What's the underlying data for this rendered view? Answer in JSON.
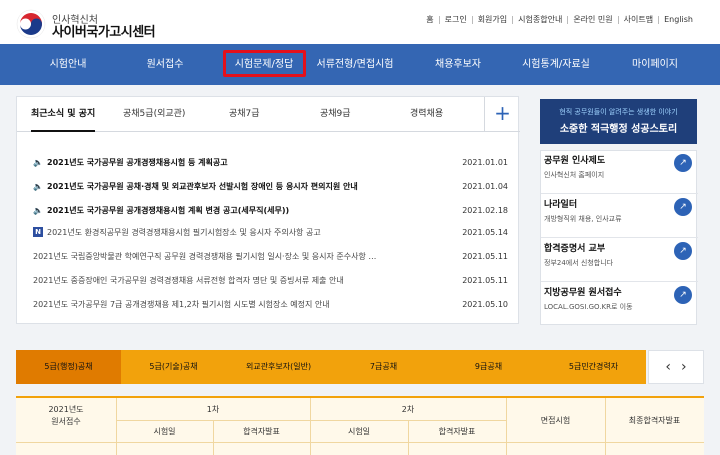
{
  "header": {
    "org_small": "인사혁신처",
    "org_title": "사이버국가고시센터",
    "util_links": [
      "홈",
      "로그인",
      "회원가입",
      "시험종합안내",
      "온라인 민원",
      "사이트맵",
      "English"
    ]
  },
  "nav": {
    "items": [
      "시험안내",
      "원서접수",
      "시험문제/정답",
      "서류전형/면접시험",
      "채용후보자",
      "시험통계/자료실",
      "마이페이지"
    ]
  },
  "news": {
    "tabs": [
      "최근소식 및 공지",
      "공채5급(외교관)",
      "공채7급",
      "공채9급",
      "경력채용"
    ],
    "plus": "+",
    "rows": [
      {
        "icon": "🔈",
        "title": "2021년도 국가공무원 공개경쟁채용시험 등 계획공고",
        "date": "2021.01.01",
        "strong": true
      },
      {
        "icon": "🔈",
        "title": "2021년도 국가공무원 공채·경채 및 외교관후보자 선발시험 장애인 등 응시자 편의지원 안내",
        "date": "2021.01.04",
        "strong": true
      },
      {
        "icon": "🔈",
        "title": "2021년도 국가공무원 공개경쟁채용시험 계획 변경 공고(세무직(세무))",
        "date": "2021.02.18",
        "strong": true
      },
      {
        "icon": "N",
        "title": "2021년도 환경직공무원 경력경쟁채용시험 필기시험장소 및 응시자 주의사항 공고",
        "date": "2021.05.14",
        "strong": false
      },
      {
        "icon": "",
        "title": "2021년도 국립중앙박물관 학예연구직 공무원 경력경쟁채용 필기시험 일시·장소 및 응시자 준수사항 …",
        "date": "2021.05.11",
        "strong": false
      },
      {
        "icon": "",
        "title": "2021년도 중증장애인 국가공무원 경력경쟁채용 서류전형 합격자 명단 및 증빙서류 제출 안내",
        "date": "2021.05.11",
        "strong": false
      },
      {
        "icon": "",
        "title": "2021년도 국가공무원 7급 공개경쟁채용 제1,2차 필기시험 시도별 시험장소 예정지 안내",
        "date": "2021.05.10",
        "strong": false
      }
    ]
  },
  "banner": {
    "line1": "현직 공무원들이 알려주는 생생한 이야기",
    "line2": "소중한 적극행정 성공스토리"
  },
  "quick_links": [
    {
      "title": "공무원 인사제도",
      "sub": "인사혁신처 홈페이지"
    },
    {
      "title": "나라일터",
      "sub": "개방형직위 채용, 인사교류"
    },
    {
      "title": "합격증명서 교부",
      "sub": "정부24에서 신청합니다"
    },
    {
      "title": "지방공무원 원서접수",
      "sub": "LOCAL.GOSI.GO.KR로 이동"
    }
  ],
  "exam_tabs": [
    "5급(행정)공채",
    "5급(기술)공채",
    "외교관후보자(일반)",
    "7급공채",
    "9급공채",
    "5급민간경력자"
  ],
  "exam_arrows": {
    "prev": "‹",
    "next": "›"
  },
  "schedule_table": {
    "col_year": "2021년도",
    "col_year2": "원서접수",
    "round1": "1차",
    "round2": "2차",
    "interview": "면접시험",
    "final": "최종합격자발표",
    "sub_exam": "시험일",
    "sub_result": "합격자발표"
  },
  "colors": {
    "nav_bg": "#3466b3",
    "highlight": "#e4101b",
    "exam_tab_bg": "#f2a20c",
    "exam_tab_active": "#e07b00",
    "banner_bg": "#1f3f7a"
  }
}
